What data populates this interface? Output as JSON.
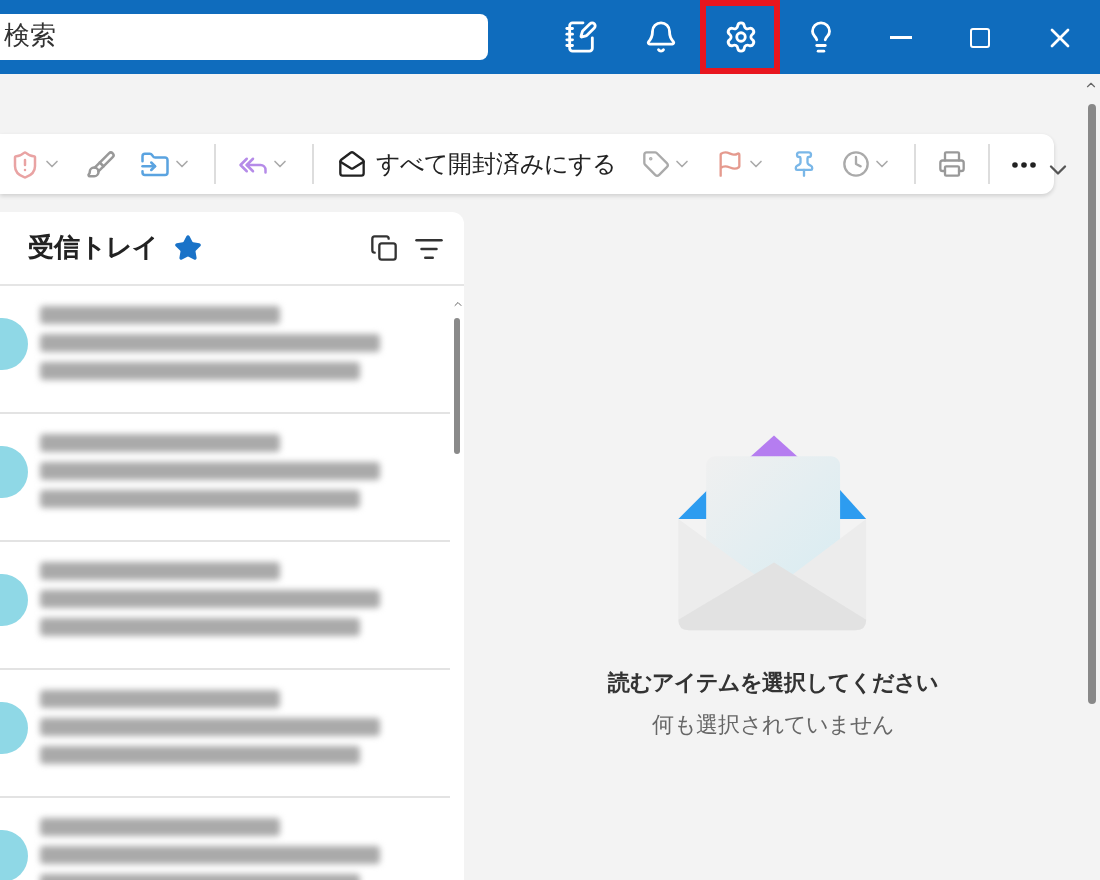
{
  "title_bar": {
    "search_placeholder": "検索",
    "settings_highlighted": true
  },
  "toolbar": {
    "mark_all_read": "すべて開封済みにする"
  },
  "inbox": {
    "title": "受信トレイ",
    "favorite": true,
    "messages": [
      {
        "kind": "blurred"
      },
      {
        "kind": "blurred"
      },
      {
        "kind": "blurred"
      },
      {
        "kind": "blurred"
      },
      {
        "kind": "blurred"
      }
    ]
  },
  "reading_pane": {
    "heading": "読むアイテムを選択してください",
    "subtext": "何も選択されていません"
  }
}
